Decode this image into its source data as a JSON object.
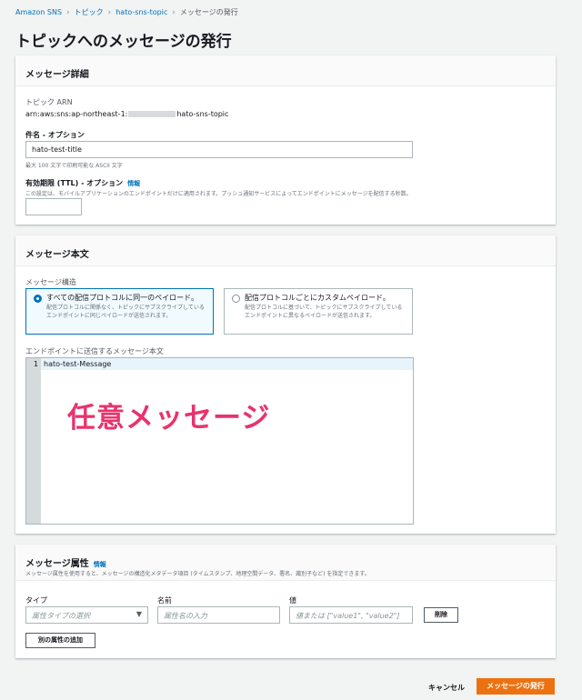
{
  "breadcrumb": {
    "items": [
      "Amazon SNS",
      "トピック",
      "hato-sns-topic"
    ],
    "current": "メッセージの発行"
  },
  "page_title": "トピックへのメッセージの発行",
  "details": {
    "title": "メッセージ詳細",
    "arn_label": "トピック ARN",
    "arn_prefix": "arn:aws:sns:ap-northeast-1:",
    "arn_suffix": "hato-sns-topic",
    "subject_label": "件名 - オプション",
    "subject_value": "hato-test-title",
    "subject_hint": "最大 100 文字で印刷可能な ASCII 文字",
    "ttl_label": "有効期限 (TTL) - オプション",
    "ttl_info": "情報",
    "ttl_hint": "この設定は、モバイルアプリケーションのエンドポイントだけに適用されます。プッシュ通知サービスによってエンドポイントにメッセージを配信する秒数。",
    "ttl_value": ""
  },
  "body": {
    "title": "メッセージ本文",
    "structure_label": "メッセージ構造",
    "options": [
      {
        "title": "すべての配信プロトコルに同一のペイロード。",
        "desc": "配信プロトコルに関係なく、トピックにサブスクライブしているエンドポイントに同じペイロードが送信されます。",
        "selected": true
      },
      {
        "title": "配信プロトコルごとにカスタムペイロード。",
        "desc": "配信プロトコルに基づいて、トピックにサブスクライブしているエンドポイントに異なるペイロードが送信されます。",
        "selected": false
      }
    ],
    "editor_label": "エンドポイントに送信するメッセージ本文",
    "editor_line_number": "1",
    "editor_text": "hato-test-Message",
    "annotation": "任意メッセージ"
  },
  "attributes": {
    "title": "メッセージ属性",
    "info": "情報",
    "desc": "メッセージ属性を使用すると、メッセージの構造化メタデータ項目 (タイムスタンプ、地理空間データ、署名、識別子など) を指定できます。",
    "type_label": "タイプ",
    "type_placeholder": "属性タイプの選択",
    "name_label": "名前",
    "name_placeholder": "属性名の入力",
    "value_label": "値",
    "value_placeholder": "値または [\"value1\", \"value2\"]",
    "remove_label": "削除",
    "add_label": "別の属性の追加"
  },
  "footer": {
    "cancel_label": "キャンセル",
    "publish_label": "メッセージの発行"
  },
  "colors": {
    "accent": "#0073bb",
    "primary_button": "#ec7211",
    "annotation": "#e8336d"
  }
}
